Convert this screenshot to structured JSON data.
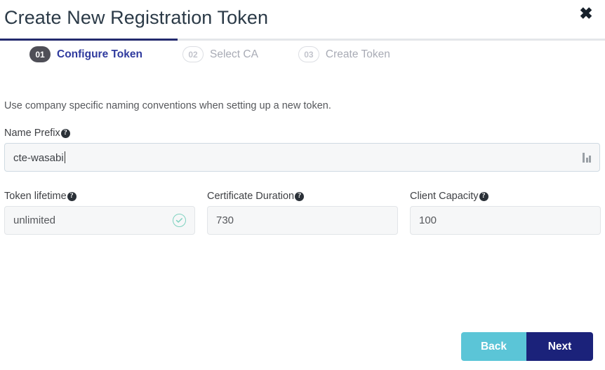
{
  "dialog": {
    "title": "Create New Registration Token",
    "close_label": "✖"
  },
  "stepper": {
    "steps": [
      {
        "number": "01",
        "label": "Configure Token",
        "state": "active"
      },
      {
        "number": "02",
        "label": "Select CA",
        "state": "inactive"
      },
      {
        "number": "03",
        "label": "Create Token",
        "state": "inactive"
      }
    ]
  },
  "content": {
    "description": "Use company specific naming conventions when setting up a new token.",
    "help_glyph": "?"
  },
  "fields": {
    "name_prefix": {
      "label": "Name Prefix",
      "value": "cte-wasabi",
      "placeholder": "",
      "adornment_icon": "bar-chart-icon"
    },
    "token_lifetime": {
      "label": "Token lifetime",
      "value": "unlimited",
      "placeholder": "",
      "status_icon": "check-circle-icon"
    },
    "certificate_duration": {
      "label": "Certificate Duration",
      "value": "730",
      "placeholder": ""
    },
    "client_capacity": {
      "label": "Client Capacity",
      "value": "100",
      "placeholder": ""
    }
  },
  "footer": {
    "back_label": "Back",
    "next_label": "Next"
  },
  "colors": {
    "accent_navy": "#1b227a",
    "accent_teal": "#5bc5d7",
    "step_active_text": "#2f3a9e",
    "success_green": "#7fd2c0",
    "title_text": "#2b3a47"
  }
}
